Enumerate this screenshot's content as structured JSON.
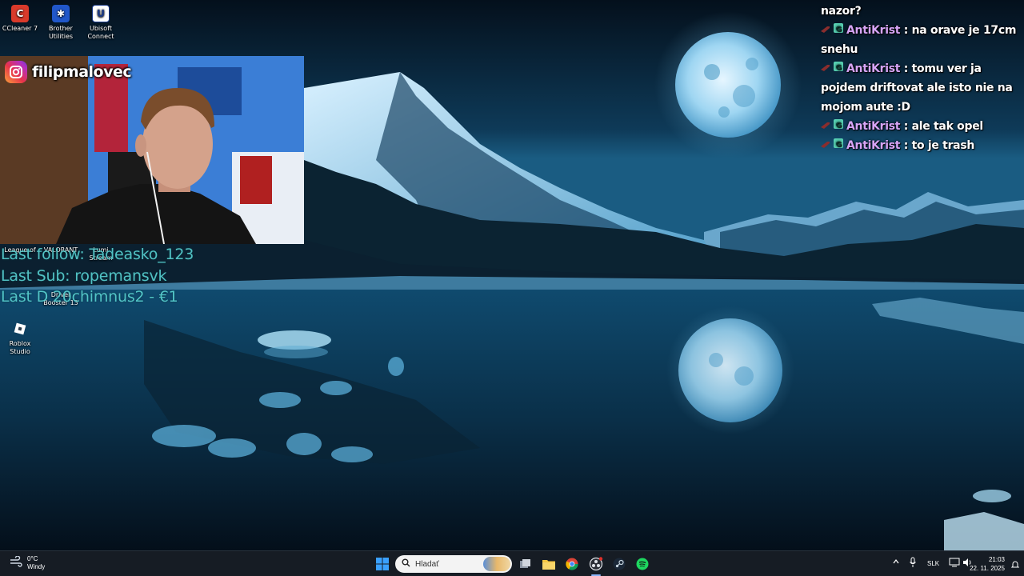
{
  "desktop": {
    "icons": [
      {
        "label": "CCleaner 7",
        "icon": "ccleaner-icon",
        "color": "#d93a2b"
      },
      {
        "label": "Brother\nUtilities",
        "icon": "brother-utilities-icon",
        "color": "#2157c9"
      },
      {
        "label": "Ubisoft\nConnect",
        "icon": "ubisoft-connect-icon",
        "color": "#ffffff"
      },
      {
        "label": "League of",
        "icon": "league-of-legends-icon",
        "color": "#2b3a4a"
      },
      {
        "label": "VALORANT",
        "icon": "valorant-icon",
        "color": "#fa4454"
      },
      {
        "label": "Lumi\nStream",
        "icon": "lumia-stream-icon",
        "color": "#2c7be5"
      },
      {
        "label": "Driver\nBooster 13",
        "icon": "driver-booster-icon",
        "color": "#d6262d"
      },
      {
        "label": "Roblox\nStudio",
        "icon": "roblox-studio-icon",
        "color": "#ffffff"
      }
    ]
  },
  "overlay": {
    "instagram_handle": "filipmalovec",
    "last_follow": "Last follow: Tadeasko_123",
    "last_sub": "Last Sub: ropemansvk",
    "last_donation": "Last D 20chimnus2 - €1"
  },
  "chat": {
    "messages": [
      {
        "user": "",
        "text": "nazor?"
      },
      {
        "user": "AntiKrist",
        "text": ": na orave je 17cm snehu"
      },
      {
        "user": "AntiKrist",
        "text": ": tomu ver ja pojdem driftovat ale isto nie na mojom aute :D"
      },
      {
        "user": "AntiKrist",
        "text": ": ale tak opel"
      },
      {
        "user": "AntiKrist",
        "text": ": to je trash"
      }
    ]
  },
  "taskbar": {
    "weather_temp": "0°C",
    "weather_text": "Windy",
    "search_placeholder": "Hladať",
    "language": "SLK",
    "time": "21:03",
    "date": "22. 11. 2025",
    "apps": [
      "start-icon",
      "task-view-icon",
      "file-explorer-icon",
      "chrome-icon",
      "obs-icon",
      "steam-icon",
      "spotify-icon"
    ]
  },
  "colors": {
    "accent_stat": "#58cfd0",
    "chat_user": "#d6a4f5",
    "taskbar_bg": "#161c24"
  }
}
